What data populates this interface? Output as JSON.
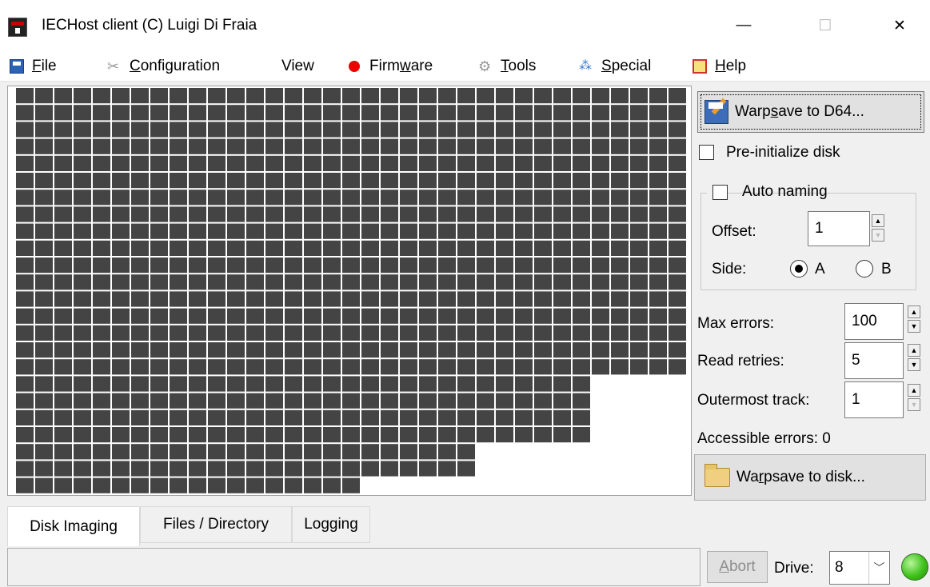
{
  "window": {
    "title": "IECHost client (C) Luigi Di Fraia",
    "minimize": "—",
    "maximize": "☐",
    "close": "✕"
  },
  "menu": {
    "file": {
      "pre": "",
      "ul": "F",
      "post": "ile"
    },
    "configuration": {
      "pre": "",
      "ul": "C",
      "post": "onfiguration"
    },
    "view": {
      "pre": "View",
      "ul": "",
      "post": ""
    },
    "firmware": {
      "pre": "Firm",
      "ul": "w",
      "post": "are"
    },
    "tools": {
      "pre": "",
      "ul": "T",
      "post": "ools"
    },
    "special": {
      "pre": "",
      "ul": "S",
      "post": "pecial"
    },
    "help": {
      "pre": "",
      "ul": "H",
      "post": "elp"
    }
  },
  "disk_map": {
    "track_count": 24,
    "sectors_per_track": [
      35,
      35,
      35,
      35,
      35,
      35,
      35,
      35,
      35,
      35,
      35,
      35,
      35,
      35,
      35,
      35,
      35,
      30,
      30,
      30,
      30,
      24,
      24,
      18
    ],
    "block_color": "#444444"
  },
  "right_panel": {
    "warpsave_d64": {
      "pre": "Warp",
      "ul": "s",
      "post": "ave to D64..."
    },
    "pre_initialize_disk": "Pre-initialize disk",
    "auto_naming": "Auto naming",
    "offset_label": "Offset:",
    "offset_value": "1",
    "side_label": "Side:",
    "side_a": "A",
    "side_b": "B",
    "side_selected": "A",
    "max_errors_label": "Max errors:",
    "max_errors_value": "100",
    "read_retries_label": "Read retries:",
    "read_retries_value": "5",
    "outermost_track_label": "Outermost track:",
    "outermost_track_value": "1",
    "accessible_errors": "Accessible errors: 0",
    "warpsave_disk": {
      "pre": "Wa",
      "ul": "r",
      "post": "psave to disk..."
    }
  },
  "tabs": [
    "Disk Imaging",
    "Files / Directory",
    "Logging"
  ],
  "active_tab": "Disk Imaging",
  "statusbar": {
    "abort": {
      "ul": "A",
      "post": "bort"
    },
    "drive_label": "Drive:",
    "drive_value": "8",
    "led_color": "#3fc21c"
  }
}
